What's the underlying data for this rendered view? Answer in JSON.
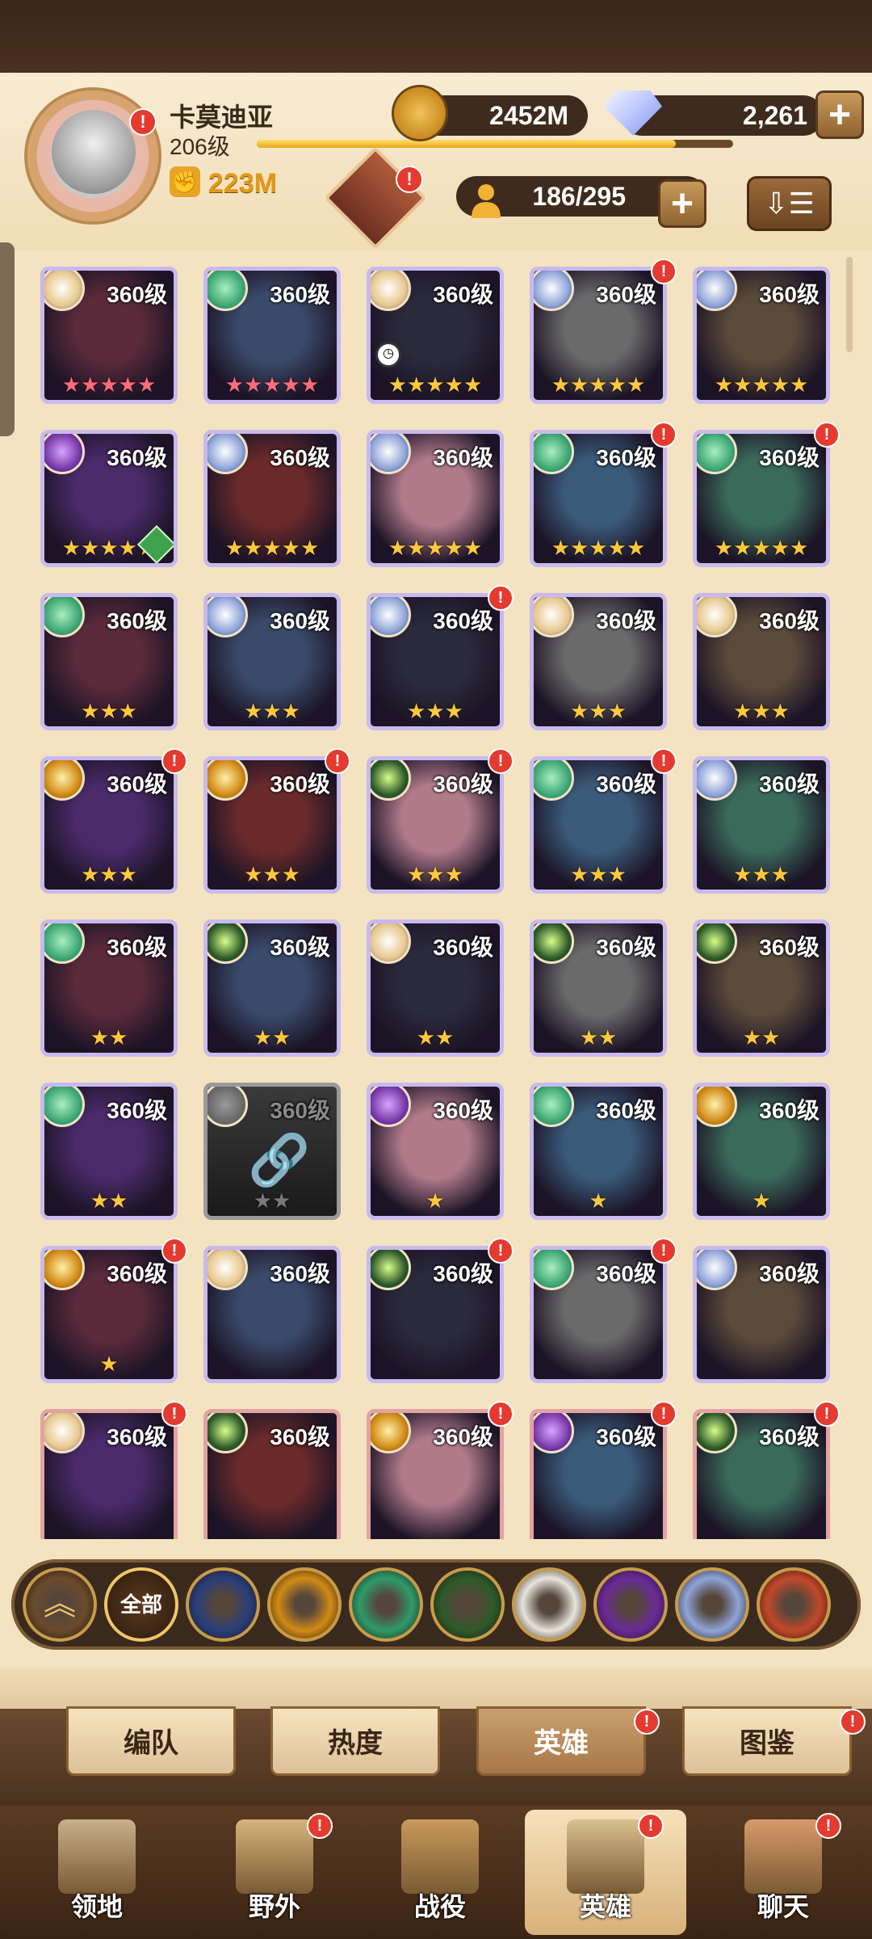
{
  "profile": {
    "name": "卡莫迪亚",
    "level": "206级",
    "xp_progress": 0.88,
    "power": "223M"
  },
  "resources": {
    "gold": "2452M",
    "diamonds": "2,261",
    "heroes_count": "186/295"
  },
  "colors": {
    "gold_text": "#e39a16",
    "badge_red": "#e43a2f",
    "card_purple": "#c8b9ee",
    "card_red": "#e3a3a3"
  },
  "heroes": [
    {
      "level": "360级",
      "faction": "celestial",
      "stars": "★★★★★",
      "star_color": "#ff6b7a",
      "frame": "purple",
      "badge": false
    },
    {
      "level": "360级",
      "faction": "wilder",
      "stars": "★★★★★",
      "star_color": "#ff6b7a",
      "frame": "purple",
      "badge": false
    },
    {
      "level": "360级",
      "faction": "celestial",
      "stars": "★★★★★",
      "star_color": "#ffc83d",
      "frame": "purple",
      "badge": false,
      "timer": true
    },
    {
      "level": "360级",
      "faction": "dimensional",
      "stars": "★★★★★",
      "star_color": "#ffc83d",
      "frame": "purple",
      "badge": true
    },
    {
      "level": "360级",
      "faction": "dimensional",
      "stars": "★★★★★",
      "star_color": "#ffc83d",
      "frame": "purple",
      "badge": false
    },
    {
      "level": "360级",
      "faction": "hypogean",
      "stars": "★★★★★",
      "star_color": "#ffc83d",
      "frame": "purple",
      "badge": false,
      "hourglass": true
    },
    {
      "level": "360级",
      "faction": "dimensional",
      "stars": "★★★★★",
      "star_color": "#ffc83d",
      "frame": "purple",
      "badge": false
    },
    {
      "level": "360级",
      "faction": "dimensional",
      "stars": "★★★★★",
      "star_color": "#ffc83d",
      "frame": "purple",
      "badge": false
    },
    {
      "level": "360级",
      "faction": "wilder",
      "stars": "★★★★★",
      "star_color": "#ffc83d",
      "frame": "purple",
      "badge": true
    },
    {
      "level": "360级",
      "faction": "wilder",
      "stars": "★★★★★",
      "star_color": "#ffc83d",
      "frame": "purple",
      "badge": true
    },
    {
      "level": "360级",
      "faction": "wilder",
      "stars": "★★★",
      "star_color": "#ffc83d",
      "frame": "purple",
      "badge": false
    },
    {
      "level": "360级",
      "faction": "dimensional",
      "stars": "★★★",
      "star_color": "#ffc83d",
      "frame": "purple",
      "badge": false
    },
    {
      "level": "360级",
      "faction": "dimensional",
      "stars": "★★★",
      "star_color": "#ffc83d",
      "frame": "purple",
      "badge": true
    },
    {
      "level": "360级",
      "faction": "celestial",
      "stars": "★★★",
      "star_color": "#ffc83d",
      "frame": "purple",
      "badge": false
    },
    {
      "level": "360级",
      "faction": "celestial",
      "stars": "★★★",
      "star_color": "#ffc83d",
      "frame": "purple",
      "badge": false
    },
    {
      "level": "360级",
      "faction": "graveborn",
      "stars": "★★★",
      "star_color": "#ffc83d",
      "frame": "purple",
      "badge": true
    },
    {
      "level": "360级",
      "faction": "graveborn",
      "stars": "★★★",
      "star_color": "#ffc83d",
      "frame": "purple",
      "badge": true
    },
    {
      "level": "360级",
      "faction": "mauler",
      "stars": "★★★",
      "star_color": "#ffc83d",
      "frame": "purple",
      "badge": true
    },
    {
      "level": "360级",
      "faction": "wilder",
      "stars": "★★★",
      "star_color": "#ffc83d",
      "frame": "purple",
      "badge": true
    },
    {
      "level": "360级",
      "faction": "dimensional",
      "stars": "★★★",
      "star_color": "#ffc83d",
      "frame": "purple",
      "badge": false
    },
    {
      "level": "360级",
      "faction": "wilder",
      "stars": "★★",
      "star_color": "#ffc83d",
      "frame": "purple",
      "badge": false
    },
    {
      "level": "360级",
      "faction": "mauler",
      "stars": "★★",
      "star_color": "#ffc83d",
      "frame": "purple",
      "badge": false
    },
    {
      "level": "360级",
      "faction": "celestial",
      "stars": "★★",
      "star_color": "#ffc83d",
      "frame": "purple",
      "badge": false
    },
    {
      "level": "360级",
      "faction": "mauler",
      "stars": "★★",
      "star_color": "#ffc83d",
      "frame": "purple",
      "badge": false
    },
    {
      "level": "360级",
      "faction": "mauler",
      "stars": "★★",
      "star_color": "#ffc83d",
      "frame": "purple",
      "badge": false
    },
    {
      "level": "360级",
      "faction": "wilder",
      "stars": "★★",
      "star_color": "#ffc83d",
      "frame": "purple",
      "badge": false
    },
    {
      "level": "360级",
      "faction": "locked",
      "stars": "★★",
      "star_color": "#7a7a7a",
      "frame": "gray",
      "badge": false,
      "locked": true
    },
    {
      "level": "360级",
      "faction": "hypogean",
      "stars": "★",
      "star_color": "#ffc83d",
      "frame": "purple",
      "badge": false
    },
    {
      "level": "360级",
      "faction": "wilder",
      "stars": "★",
      "star_color": "#ffc83d",
      "frame": "purple",
      "badge": false
    },
    {
      "level": "360级",
      "faction": "graveborn",
      "stars": "★",
      "star_color": "#ffc83d",
      "frame": "purple",
      "badge": false
    },
    {
      "level": "360级",
      "faction": "graveborn",
      "stars": "★",
      "star_color": "#ffc83d",
      "frame": "purple",
      "badge": true
    },
    {
      "level": "360级",
      "faction": "celestial",
      "stars": "",
      "star_color": "#ffc83d",
      "frame": "purple",
      "badge": false
    },
    {
      "level": "360级",
      "faction": "mauler",
      "stars": "",
      "star_color": "#ffc83d",
      "frame": "purple",
      "badge": true
    },
    {
      "level": "360级",
      "faction": "wilder",
      "stars": "",
      "star_color": "#ffc83d",
      "frame": "purple",
      "badge": true
    },
    {
      "level": "360级",
      "faction": "dimensional",
      "stars": "",
      "star_color": "#ffc83d",
      "frame": "purple",
      "badge": false
    },
    {
      "level": "360级",
      "faction": "celestial",
      "stars": "",
      "star_color": "#ffc83d",
      "frame": "red",
      "badge": true
    },
    {
      "level": "360级",
      "faction": "mauler",
      "stars": "",
      "star_color": "#ffc83d",
      "frame": "red",
      "badge": false
    },
    {
      "level": "360级",
      "faction": "graveborn",
      "stars": "",
      "star_color": "#ffc83d",
      "frame": "red",
      "badge": true
    },
    {
      "level": "360级",
      "faction": "hypogean",
      "stars": "",
      "star_color": "#ffc83d",
      "frame": "red",
      "badge": true
    },
    {
      "level": "360级",
      "faction": "mauler",
      "stars": "",
      "star_color": "#ffc83d",
      "frame": "red",
      "badge": true
    }
  ],
  "filters": [
    {
      "name": "collapse-icon",
      "label": "",
      "color": "#6a4a2a"
    },
    {
      "name": "all",
      "label": "全部",
      "color": "#3a2414"
    },
    {
      "name": "lightbearer-icon",
      "label": "",
      "color": "#2a3e7a"
    },
    {
      "name": "graveborn-icon",
      "label": "",
      "color": "#d18a16"
    },
    {
      "name": "wilder-icon",
      "label": "",
      "color": "#2f9a6a"
    },
    {
      "name": "mauler-icon",
      "label": "",
      "color": "#2e5a2a"
    },
    {
      "name": "celestial-icon",
      "label": "",
      "color": "#e8e4dc"
    },
    {
      "name": "hypogean-icon",
      "label": "",
      "color": "#6a2a9a"
    },
    {
      "name": "dimensional-icon",
      "label": "",
      "color": "#8fa4d8"
    },
    {
      "name": "druid-icon",
      "label": "",
      "color": "#c2482a"
    }
  ],
  "subtabs": [
    {
      "label": "编队",
      "active": false,
      "badge": false
    },
    {
      "label": "热度",
      "active": false,
      "badge": false
    },
    {
      "label": "英雄",
      "active": true,
      "badge": true
    },
    {
      "label": "图鉴",
      "active": false,
      "badge": true
    }
  ],
  "nav": [
    {
      "label": "领地",
      "active": false,
      "badge": false
    },
    {
      "label": "野外",
      "active": false,
      "badge": true
    },
    {
      "label": "战役",
      "active": false,
      "badge": false
    },
    {
      "label": "英雄",
      "active": true,
      "badge": true
    },
    {
      "label": "聊天",
      "active": false,
      "badge": true
    }
  ]
}
